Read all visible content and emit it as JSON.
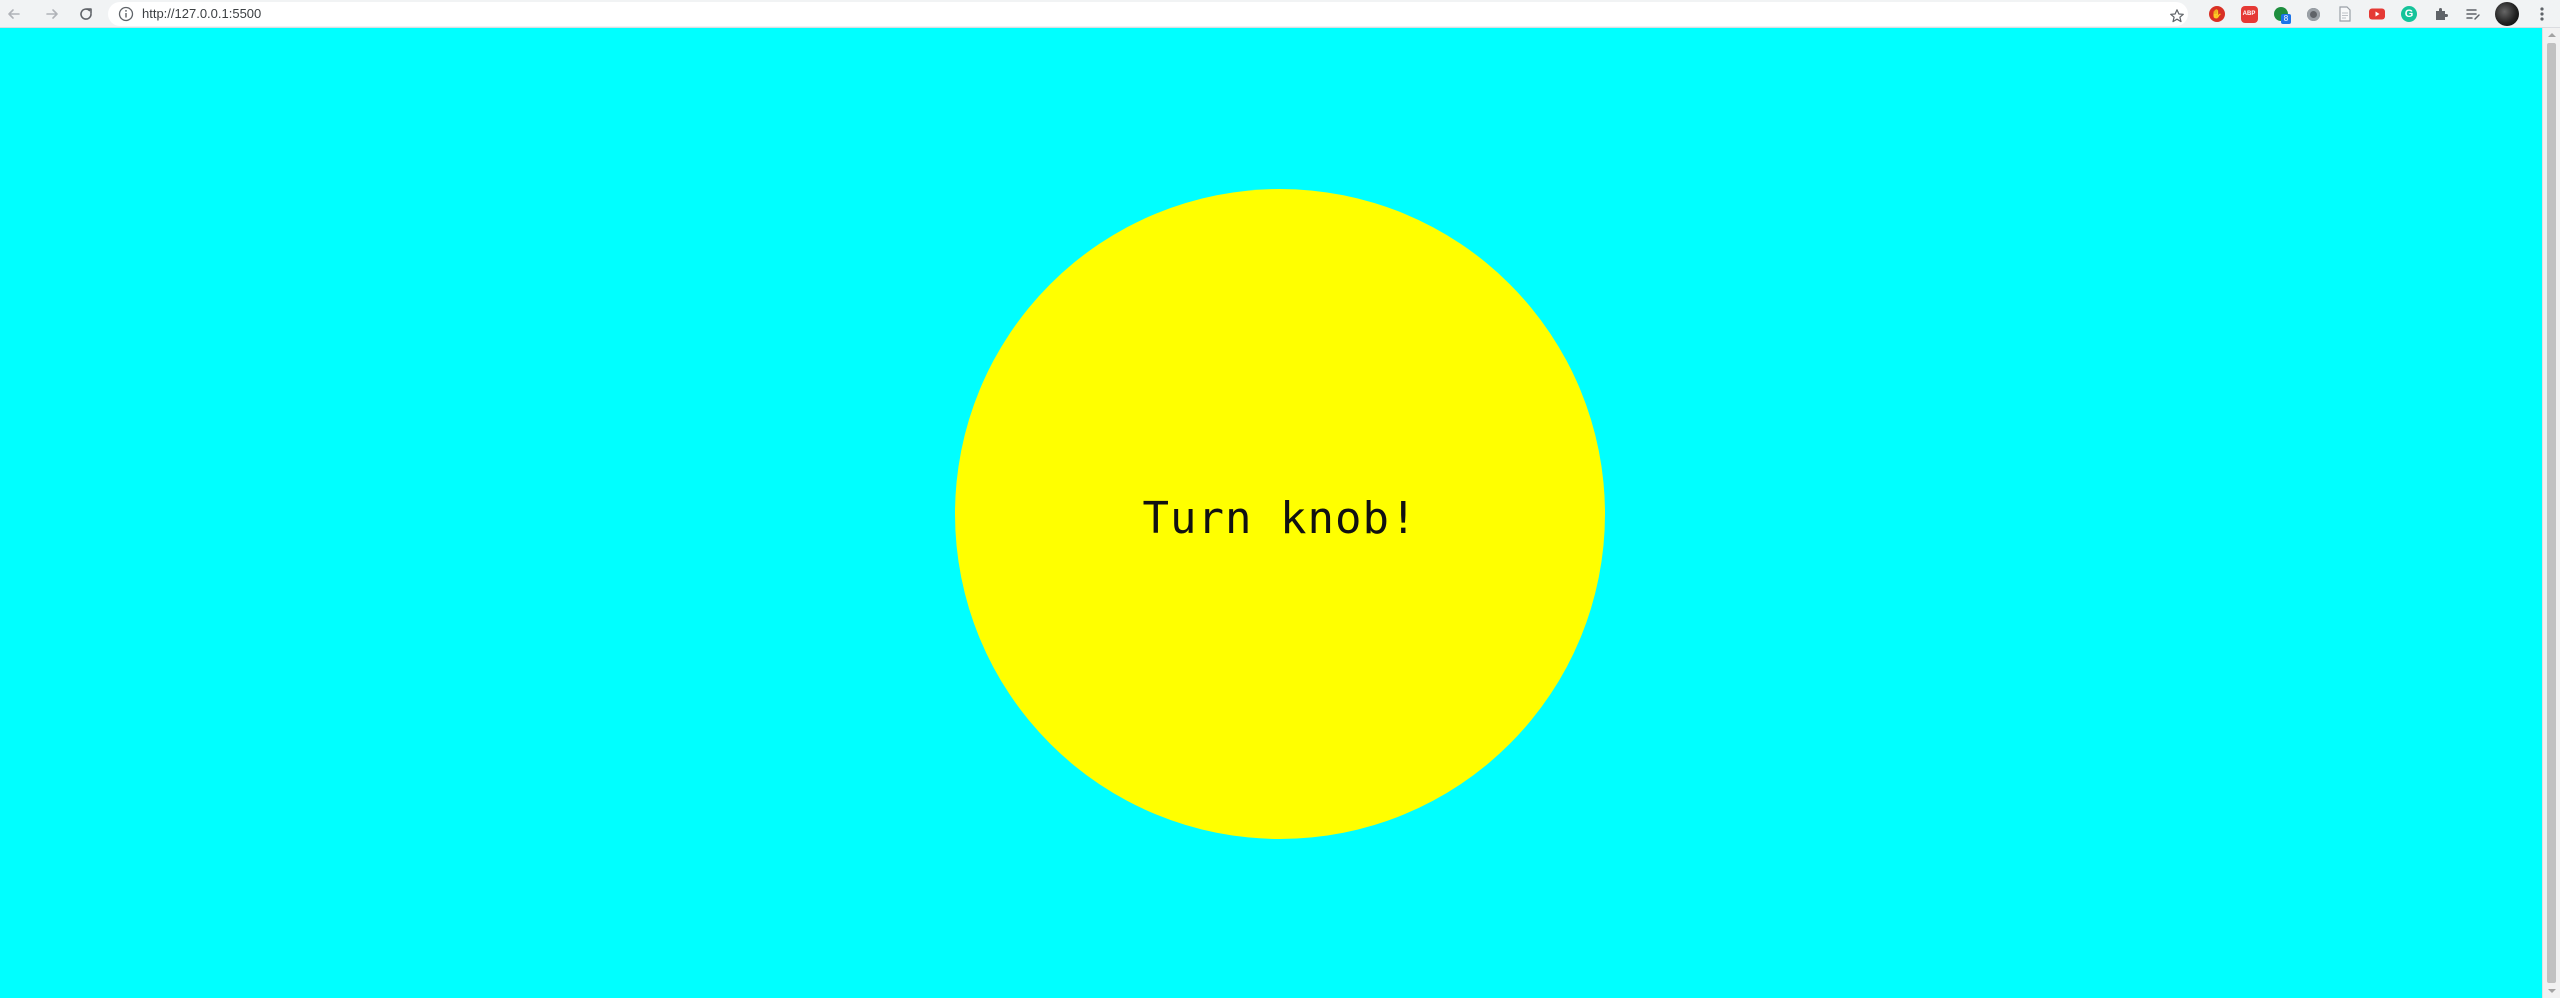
{
  "browser": {
    "url": "http://127.0.0.1:5500",
    "nav": {
      "back_icon": "arrow-left-icon",
      "forward_icon": "arrow-right-icon",
      "reload_icon": "reload-icon"
    },
    "bookmark_icon": "star-icon",
    "extensions": [
      {
        "name": "extension-red-hand-icon",
        "color": "#d93025"
      },
      {
        "name": "extension-adblock-icon",
        "color": "#e53935",
        "text": "ABP"
      },
      {
        "name": "extension-green-dot-icon",
        "color": "#1e8e3e",
        "badge": "8"
      },
      {
        "name": "extension-grey-circle-icon",
        "color": "#5f6368"
      },
      {
        "name": "extension-document-icon",
        "color": "#9aa0a6"
      },
      {
        "name": "extension-youtube-icon",
        "color": "#e53935"
      },
      {
        "name": "extension-grammarly-icon",
        "color": "#15c39a",
        "text": "G"
      },
      {
        "name": "puzzle-icon",
        "color": "#5f6368"
      },
      {
        "name": "reading-list-icon",
        "color": "#5f6368"
      }
    ],
    "avatar_icon": "profile-avatar",
    "menu_icon": "more-vertical-icon"
  },
  "page": {
    "background_color": "#00ffff",
    "knob": {
      "label": "Turn knob!",
      "color": "#ffff00"
    }
  }
}
